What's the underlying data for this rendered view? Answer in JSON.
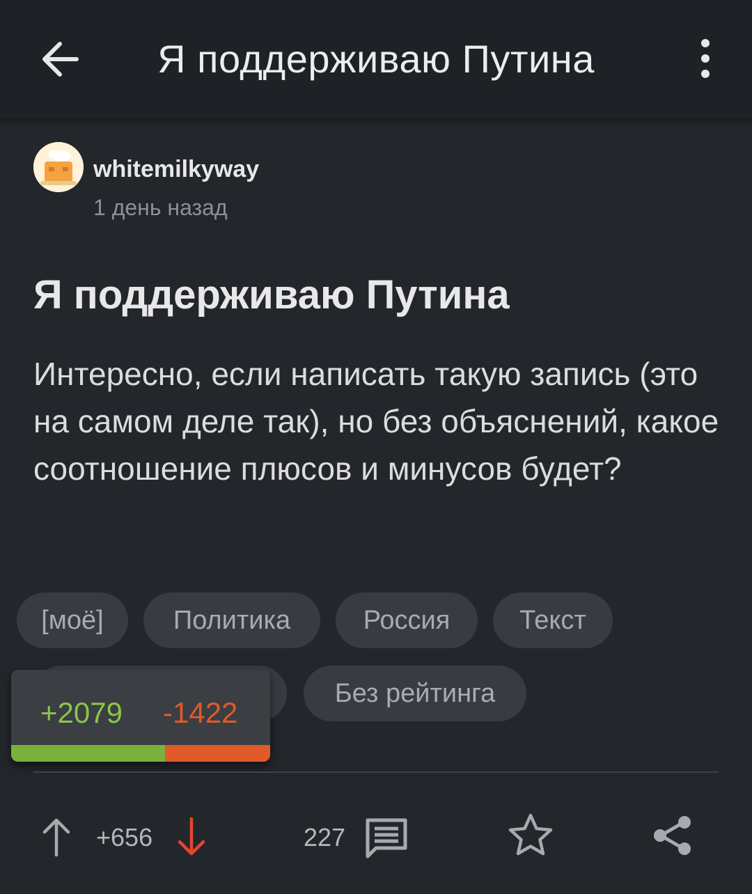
{
  "header": {
    "title": "Я поддерживаю Путина",
    "back_icon": "arrow-left-icon",
    "menu_icon": "more-vertical-icon"
  },
  "post": {
    "author": "whitemilkyway",
    "time": "1 день назад",
    "title": "Я поддерживаю Путина",
    "body": "Интересно, если написать такую запись (это на самом деле так), но без объяснений, какое соотношение плюсов и минусов будет?",
    "tags": [
      "[моё]",
      "Политика",
      "Россия",
      "Текст",
      "Без рейтинга"
    ]
  },
  "votes": {
    "plus": "+2079",
    "minus": "-1422",
    "plus_value": 2079,
    "minus_value": 1422,
    "colors": {
      "plus": "#7cb03c",
      "minus": "#e05a2a"
    }
  },
  "actions": {
    "rating": "+656",
    "comments": "227",
    "upvote_icon": "arrow-up-icon",
    "downvote_icon": "arrow-down-icon",
    "comments_icon": "comment-icon",
    "save_icon": "star-icon",
    "share_icon": "share-icon"
  }
}
